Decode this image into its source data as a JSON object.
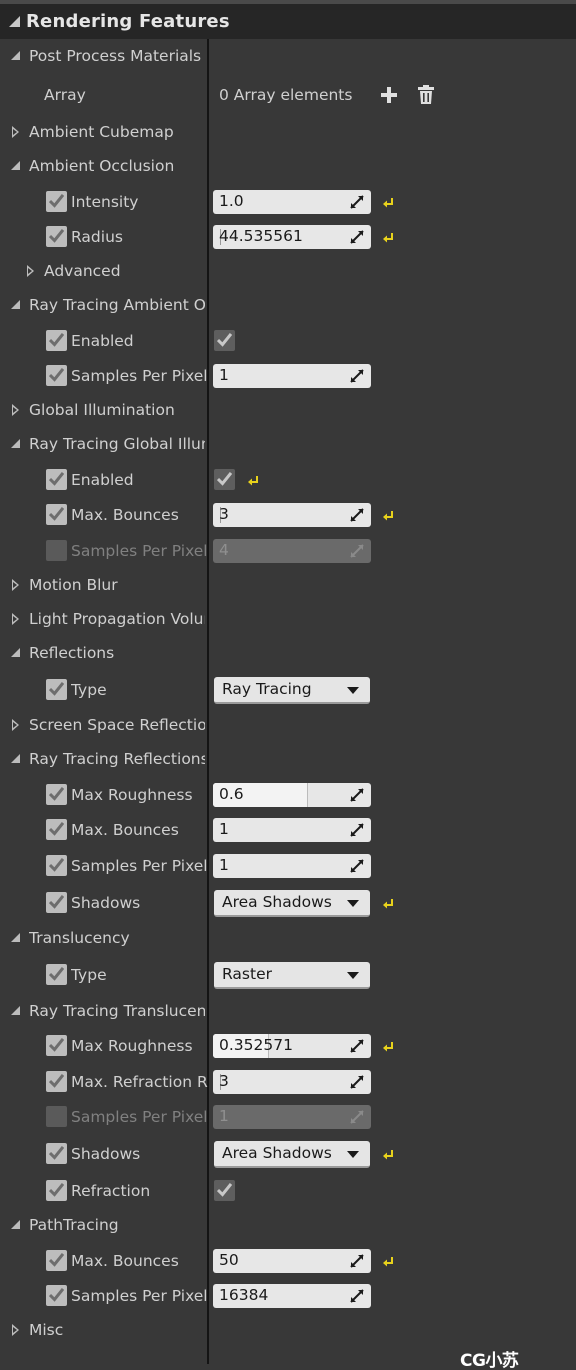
{
  "panel": {
    "title": "Rendering Features"
  },
  "post_process": {
    "label": "Post Process Materials",
    "array_label": "Array",
    "array_value": "0 Array elements"
  },
  "ambient_cubemap": {
    "label": "Ambient Cubemap"
  },
  "ambient_occlusion": {
    "label": "Ambient Occlusion",
    "intensity": {
      "label": "Intensity",
      "value": "1.0"
    },
    "radius": {
      "label": "Radius",
      "value": "44.535561"
    },
    "advanced": "Advanced"
  },
  "rt_ao": {
    "label": "Ray Tracing Ambient Occlusion",
    "enabled": {
      "label": "Enabled"
    },
    "samples": {
      "label": "Samples Per Pixel",
      "value": "1"
    }
  },
  "global_illumination": {
    "label": "Global Illumination"
  },
  "rt_gi": {
    "label": "Ray Tracing Global Illumination",
    "enabled": {
      "label": "Enabled"
    },
    "bounces": {
      "label": "Max. Bounces",
      "value": "3"
    },
    "samples": {
      "label": "Samples Per Pixel",
      "value": "4"
    }
  },
  "motion_blur": {
    "label": "Motion Blur"
  },
  "lpv": {
    "label": "Light Propagation Volume"
  },
  "reflections": {
    "label": "Reflections",
    "type": {
      "label": "Type",
      "value": "Ray Tracing"
    }
  },
  "ssr": {
    "label": "Screen Space Reflections"
  },
  "rt_reflections": {
    "label": "Ray Tracing Reflections",
    "roughness": {
      "label": "Max Roughness",
      "value": "0.6",
      "fill": 0.6
    },
    "bounces": {
      "label": "Max. Bounces",
      "value": "1"
    },
    "samples": {
      "label": "Samples Per Pixel",
      "value": "1"
    },
    "shadows": {
      "label": "Shadows",
      "value": "Area Shadows"
    }
  },
  "translucency": {
    "label": "Translucency",
    "type": {
      "label": "Type",
      "value": "Raster"
    }
  },
  "rt_translucency": {
    "label": "Ray Tracing Translucency",
    "roughness": {
      "label": "Max Roughness",
      "value": "0.352571",
      "fill": 0.352571
    },
    "refraction_rays": {
      "label": "Max. Refraction Rays",
      "value": "3"
    },
    "samples": {
      "label": "Samples Per Pixel",
      "value": "1"
    },
    "shadows": {
      "label": "Shadows",
      "value": "Area Shadows"
    },
    "refraction": {
      "label": "Refraction"
    }
  },
  "path_tracing": {
    "label": "PathTracing",
    "bounces": {
      "label": "Max. Bounces",
      "value": "50"
    },
    "samples": {
      "label": "Samples Per Pixel",
      "value": "16384"
    }
  },
  "misc": {
    "label": "Misc"
  },
  "watermark": "CG小苏",
  "colors": {
    "panel_bg": "#383838",
    "header_bg": "#262626",
    "reset_arrow": "#e8d21c"
  }
}
